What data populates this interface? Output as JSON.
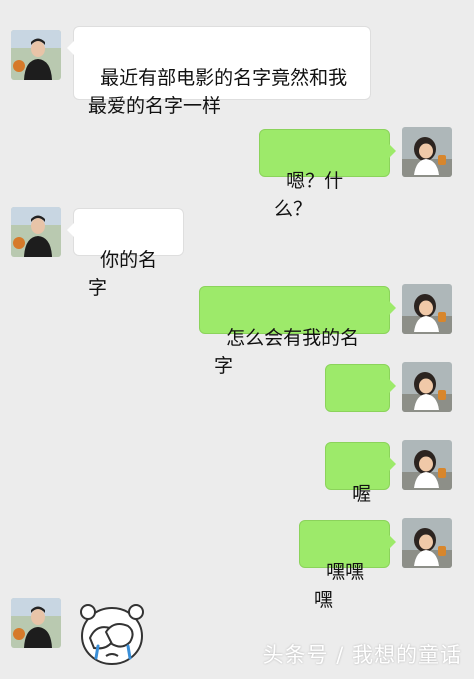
{
  "messages": [
    {
      "side": "left",
      "text": "最近有部电影的名字竟然和我\n最爱的名字一样"
    },
    {
      "side": "right",
      "text": "嗯？什么？"
    },
    {
      "side": "left",
      "text": "你的名字"
    },
    {
      "side": "right",
      "text": "怎么会有我的名字"
    },
    {
      "side": "right",
      "text": "……"
    },
    {
      "side": "right",
      "text": "喔"
    },
    {
      "side": "right",
      "text": "嘿嘿嘿"
    }
  ],
  "watermark": "头条号 / 我想的童话",
  "icons": {
    "left_avatar": "boy-avatar-icon",
    "right_avatar": "girl-avatar-icon",
    "sticker": "covering-face-sticker-icon"
  },
  "colors": {
    "background": "#ececec",
    "left_bubble": "#ffffff",
    "right_bubble": "#9dea6a"
  }
}
